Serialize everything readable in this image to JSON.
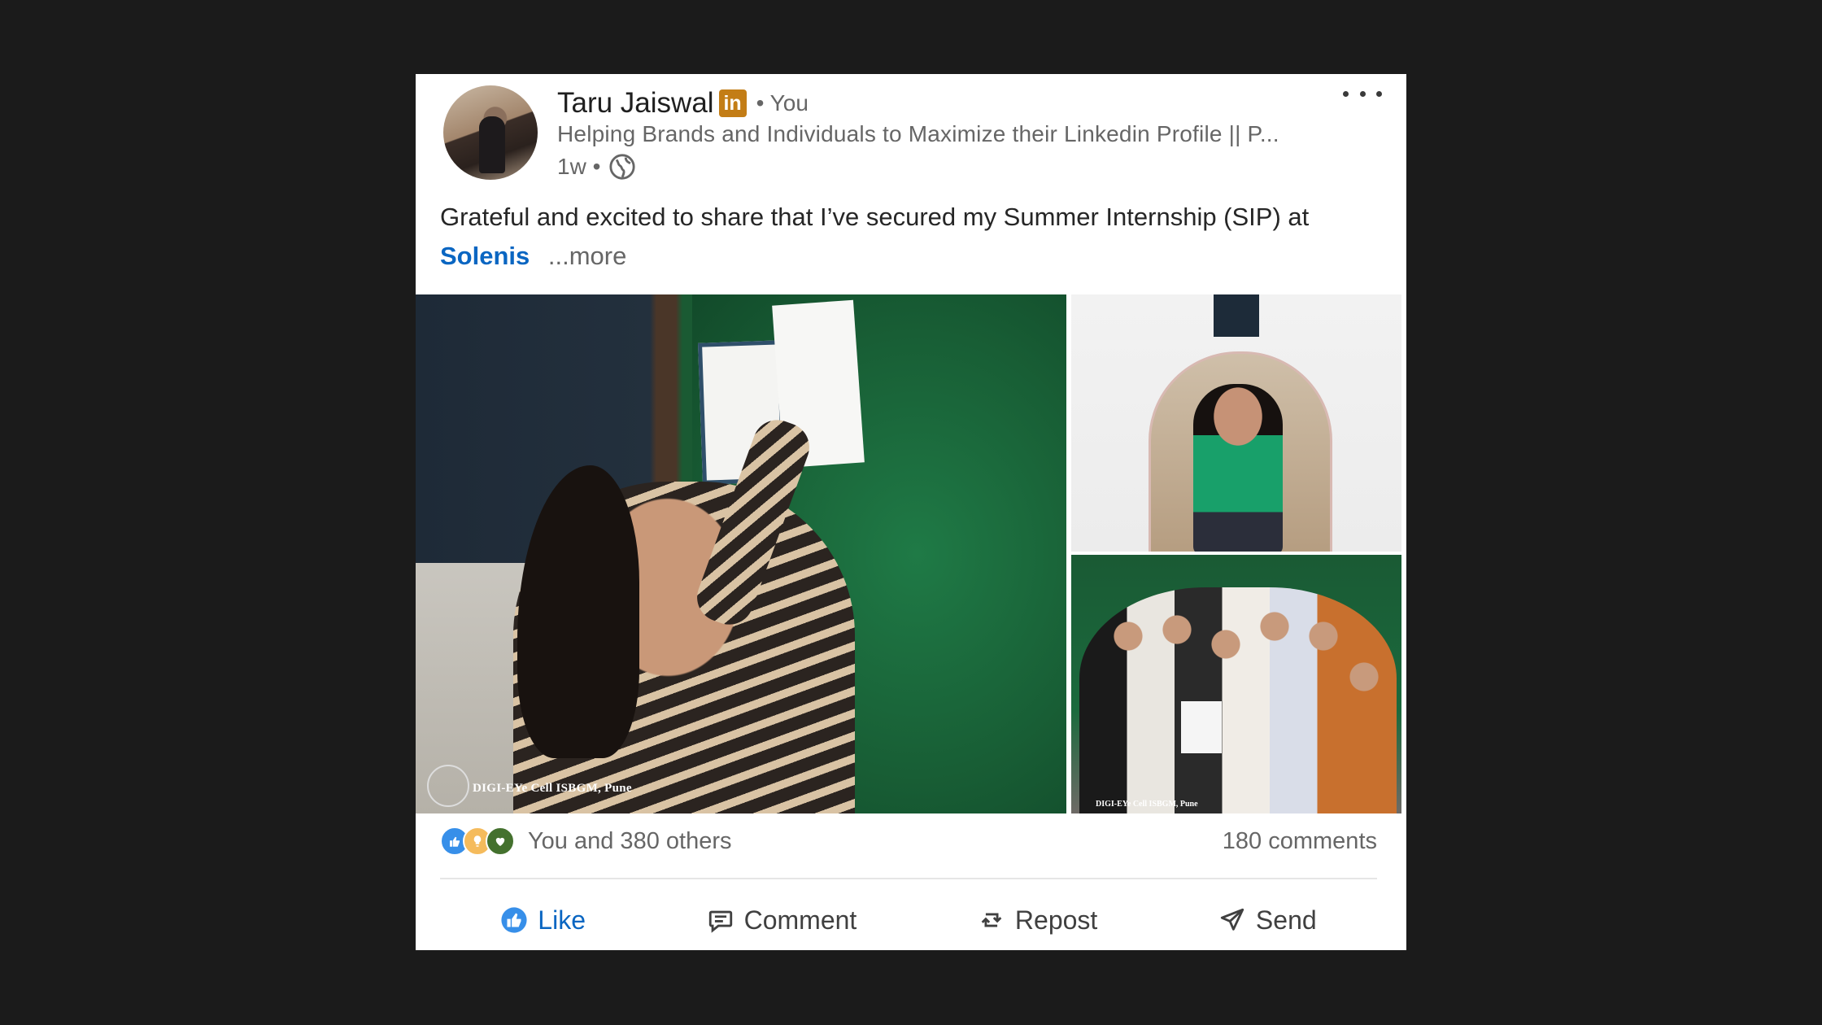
{
  "post": {
    "author": {
      "name": "Taru Jaiswal",
      "badge": "in",
      "relation": "• You",
      "headline": "Helping Brands and Individuals to Maximize their Linkedin Profile || P...",
      "time": "1w •",
      "visibility_icon": "globe-icon"
    },
    "text": {
      "line": "Grateful and excited to share that I’ve secured my Summer Internship (SIP) at",
      "mention": "Solenis",
      "see_more": "...more"
    },
    "images": {
      "main_watermark": "DIGI-EYe Cell ISBGM, Pune",
      "bottom_watermark": "DIGI-EYe Cell ISBGM, Pune"
    },
    "social": {
      "reaction_icons": [
        "like-icon",
        "insightful-icon",
        "support-icon"
      ],
      "reactions_text": "You and 380 others",
      "comments_text": "180 comments"
    },
    "actions": {
      "like": "Like",
      "comment": "Comment",
      "repost": "Repost",
      "send": "Send"
    }
  },
  "colors": {
    "background": "#1b1b1b",
    "card": "#ffffff",
    "accent": "#0a66c2",
    "badge": "#c37d16",
    "muted_text": "#666666"
  }
}
